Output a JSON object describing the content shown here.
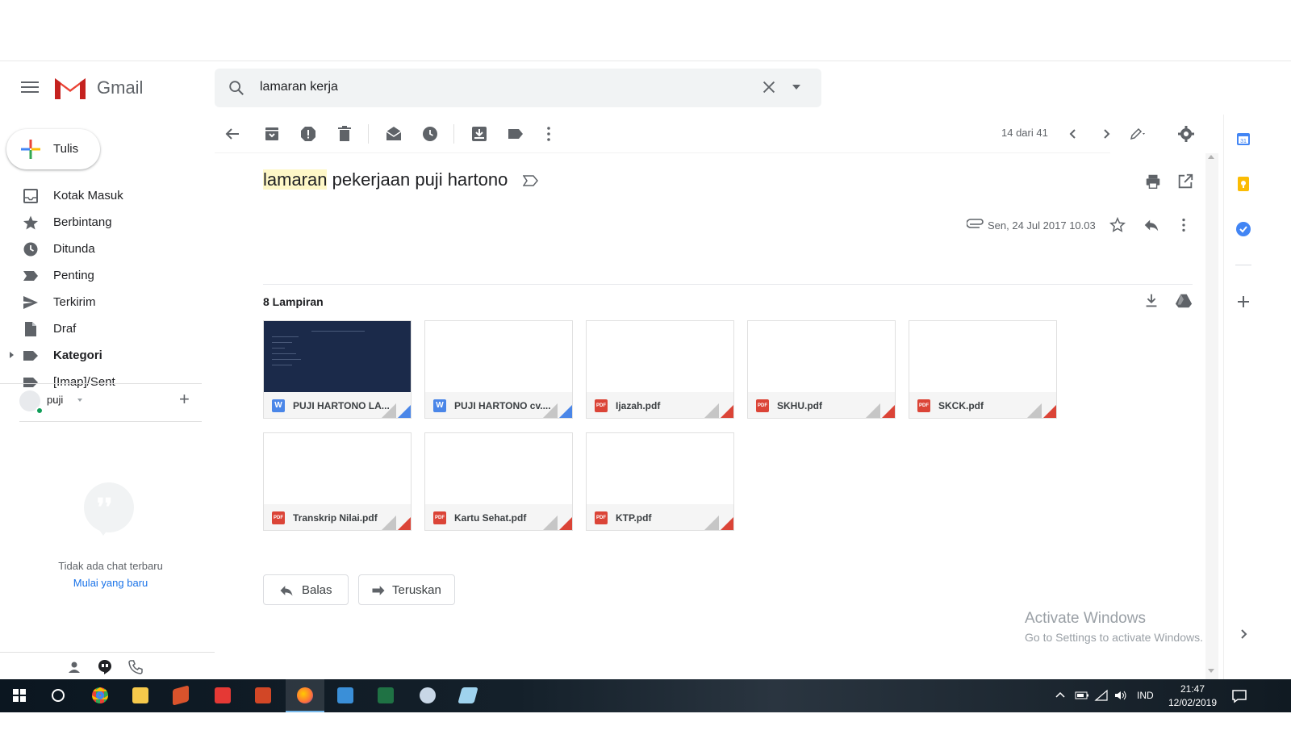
{
  "app": {
    "name": "Gmail"
  },
  "search": {
    "query": "lamaran kerja"
  },
  "compose": {
    "label": "Tulis"
  },
  "nav": [
    {
      "label": "Kotak Masuk",
      "icon": "inbox-icon"
    },
    {
      "label": "Berbintang",
      "icon": "star-icon"
    },
    {
      "label": "Ditunda",
      "icon": "clock-icon"
    },
    {
      "label": "Penting",
      "icon": "important-icon"
    },
    {
      "label": "Terkirim",
      "icon": "send-icon"
    },
    {
      "label": "Draf",
      "icon": "draft-icon"
    },
    {
      "label": "Kategori",
      "icon": "label-icon"
    },
    {
      "label": "[Imap]/Sent",
      "icon": "label-icon"
    }
  ],
  "hangouts": {
    "user": "puji",
    "empty_text": "Tidak ada chat terbaru",
    "start_new": "Mulai yang baru"
  },
  "toolbar": {
    "pager": "14 dari 41"
  },
  "email": {
    "subject_highlight": "lamaran",
    "subject_rest": " pekerjaan puji hartono",
    "date": "Sen, 24 Jul 2017 10.03"
  },
  "attachments": {
    "title": "8 Lampiran",
    "items": [
      {
        "name": "PUJI HARTONO LA...",
        "type": "word"
      },
      {
        "name": "PUJI HARTONO cv....",
        "type": "word"
      },
      {
        "name": "Ijazah.pdf",
        "type": "pdf"
      },
      {
        "name": "SKHU.pdf",
        "type": "pdf"
      },
      {
        "name": "SKCK.pdf",
        "type": "pdf"
      },
      {
        "name": "Transkrip Nilai.pdf",
        "type": "pdf"
      },
      {
        "name": "Kartu Sehat.pdf",
        "type": "pdf"
      },
      {
        "name": "KTP.pdf",
        "type": "pdf"
      }
    ],
    "badge_word": "W",
    "badge_pdf": "PDF"
  },
  "actions": {
    "reply": "Balas",
    "forward": "Teruskan"
  },
  "watermark": {
    "line1": "Activate Windows",
    "line2": "Go to Settings to activate Windows."
  },
  "taskbar": {
    "lang": "IND",
    "time": "21:47",
    "date": "12/02/2019"
  },
  "colors": {
    "accent": "#1a73e8",
    "pdf": "#db4437",
    "word": "#4a86e8",
    "highlight": "#fef7c7"
  }
}
